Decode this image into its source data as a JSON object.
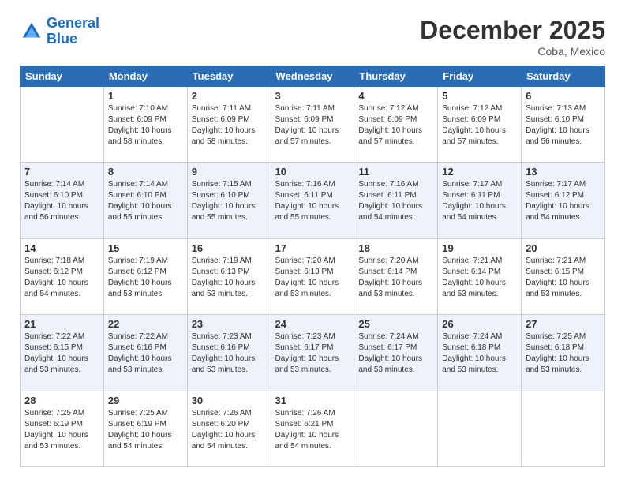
{
  "header": {
    "logo_line1": "General",
    "logo_line2": "Blue",
    "month": "December 2025",
    "location": "Coba, Mexico"
  },
  "weekdays": [
    "Sunday",
    "Monday",
    "Tuesday",
    "Wednesday",
    "Thursday",
    "Friday",
    "Saturday"
  ],
  "weeks": [
    [
      {
        "day": "",
        "info": ""
      },
      {
        "day": "1",
        "info": "Sunrise: 7:10 AM\nSunset: 6:09 PM\nDaylight: 10 hours\nand 58 minutes."
      },
      {
        "day": "2",
        "info": "Sunrise: 7:11 AM\nSunset: 6:09 PM\nDaylight: 10 hours\nand 58 minutes."
      },
      {
        "day": "3",
        "info": "Sunrise: 7:11 AM\nSunset: 6:09 PM\nDaylight: 10 hours\nand 57 minutes."
      },
      {
        "day": "4",
        "info": "Sunrise: 7:12 AM\nSunset: 6:09 PM\nDaylight: 10 hours\nand 57 minutes."
      },
      {
        "day": "5",
        "info": "Sunrise: 7:12 AM\nSunset: 6:09 PM\nDaylight: 10 hours\nand 57 minutes."
      },
      {
        "day": "6",
        "info": "Sunrise: 7:13 AM\nSunset: 6:10 PM\nDaylight: 10 hours\nand 56 minutes."
      }
    ],
    [
      {
        "day": "7",
        "info": "Sunrise: 7:14 AM\nSunset: 6:10 PM\nDaylight: 10 hours\nand 56 minutes."
      },
      {
        "day": "8",
        "info": "Sunrise: 7:14 AM\nSunset: 6:10 PM\nDaylight: 10 hours\nand 55 minutes."
      },
      {
        "day": "9",
        "info": "Sunrise: 7:15 AM\nSunset: 6:10 PM\nDaylight: 10 hours\nand 55 minutes."
      },
      {
        "day": "10",
        "info": "Sunrise: 7:16 AM\nSunset: 6:11 PM\nDaylight: 10 hours\nand 55 minutes."
      },
      {
        "day": "11",
        "info": "Sunrise: 7:16 AM\nSunset: 6:11 PM\nDaylight: 10 hours\nand 54 minutes."
      },
      {
        "day": "12",
        "info": "Sunrise: 7:17 AM\nSunset: 6:11 PM\nDaylight: 10 hours\nand 54 minutes."
      },
      {
        "day": "13",
        "info": "Sunrise: 7:17 AM\nSunset: 6:12 PM\nDaylight: 10 hours\nand 54 minutes."
      }
    ],
    [
      {
        "day": "14",
        "info": "Sunrise: 7:18 AM\nSunset: 6:12 PM\nDaylight: 10 hours\nand 54 minutes."
      },
      {
        "day": "15",
        "info": "Sunrise: 7:19 AM\nSunset: 6:12 PM\nDaylight: 10 hours\nand 53 minutes."
      },
      {
        "day": "16",
        "info": "Sunrise: 7:19 AM\nSunset: 6:13 PM\nDaylight: 10 hours\nand 53 minutes."
      },
      {
        "day": "17",
        "info": "Sunrise: 7:20 AM\nSunset: 6:13 PM\nDaylight: 10 hours\nand 53 minutes."
      },
      {
        "day": "18",
        "info": "Sunrise: 7:20 AM\nSunset: 6:14 PM\nDaylight: 10 hours\nand 53 minutes."
      },
      {
        "day": "19",
        "info": "Sunrise: 7:21 AM\nSunset: 6:14 PM\nDaylight: 10 hours\nand 53 minutes."
      },
      {
        "day": "20",
        "info": "Sunrise: 7:21 AM\nSunset: 6:15 PM\nDaylight: 10 hours\nand 53 minutes."
      }
    ],
    [
      {
        "day": "21",
        "info": "Sunrise: 7:22 AM\nSunset: 6:15 PM\nDaylight: 10 hours\nand 53 minutes."
      },
      {
        "day": "22",
        "info": "Sunrise: 7:22 AM\nSunset: 6:16 PM\nDaylight: 10 hours\nand 53 minutes."
      },
      {
        "day": "23",
        "info": "Sunrise: 7:23 AM\nSunset: 6:16 PM\nDaylight: 10 hours\nand 53 minutes."
      },
      {
        "day": "24",
        "info": "Sunrise: 7:23 AM\nSunset: 6:17 PM\nDaylight: 10 hours\nand 53 minutes."
      },
      {
        "day": "25",
        "info": "Sunrise: 7:24 AM\nSunset: 6:17 PM\nDaylight: 10 hours\nand 53 minutes."
      },
      {
        "day": "26",
        "info": "Sunrise: 7:24 AM\nSunset: 6:18 PM\nDaylight: 10 hours\nand 53 minutes."
      },
      {
        "day": "27",
        "info": "Sunrise: 7:25 AM\nSunset: 6:18 PM\nDaylight: 10 hours\nand 53 minutes."
      }
    ],
    [
      {
        "day": "28",
        "info": "Sunrise: 7:25 AM\nSunset: 6:19 PM\nDaylight: 10 hours\nand 53 minutes."
      },
      {
        "day": "29",
        "info": "Sunrise: 7:25 AM\nSunset: 6:19 PM\nDaylight: 10 hours\nand 54 minutes."
      },
      {
        "day": "30",
        "info": "Sunrise: 7:26 AM\nSunset: 6:20 PM\nDaylight: 10 hours\nand 54 minutes."
      },
      {
        "day": "31",
        "info": "Sunrise: 7:26 AM\nSunset: 6:21 PM\nDaylight: 10 hours\nand 54 minutes."
      },
      {
        "day": "",
        "info": ""
      },
      {
        "day": "",
        "info": ""
      },
      {
        "day": "",
        "info": ""
      }
    ]
  ],
  "colors": {
    "header_bg": "#2a6db5",
    "header_text": "#ffffff",
    "odd_row": "#ffffff",
    "even_row": "#eef2fa"
  }
}
